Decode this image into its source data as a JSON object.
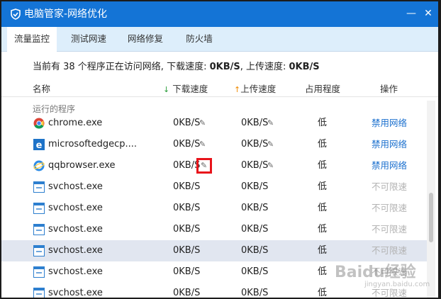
{
  "window": {
    "title": "电脑管家-网络优化",
    "minimize_glyph": "—",
    "close_glyph": "✕"
  },
  "tabs": [
    {
      "label": "流量监控",
      "active": true
    },
    {
      "label": "测试网速",
      "active": false
    },
    {
      "label": "网络修复",
      "active": false
    },
    {
      "label": "防火墙",
      "active": false
    }
  ],
  "summary": {
    "prefix": "当前有 38 个程序正在访问网络, 下载速度: ",
    "download": "0KB/S",
    "mid": ", 上传速度: ",
    "upload": "0KB/S"
  },
  "columns": {
    "name": "名称",
    "download": "下载速度",
    "upload": "上传速度",
    "usage": "占用程度",
    "action": "操作"
  },
  "group_label": "运行的程序",
  "rows": [
    {
      "name": "chrome.exe",
      "icon": "chrome-icon",
      "down": "0KB/S",
      "up": "0KB/S",
      "usage": "低",
      "action": "禁用网络"
    },
    {
      "name": "microsoftedgecp....",
      "icon": "edge-icon",
      "down": "0KB/S",
      "up": "0KB/S",
      "usage": "低",
      "action": "禁用网络"
    },
    {
      "name": "qqbrowser.exe",
      "icon": "qqbrowser-icon",
      "down": "0KB/S",
      "up": "0KB/S",
      "usage": "低",
      "action": "禁用网络"
    },
    {
      "name": "svchost.exe",
      "icon": "service-window-icon",
      "down": "0KB/S",
      "up": "0KB/S",
      "usage": "低",
      "action": "不可限速"
    },
    {
      "name": "svchost.exe",
      "icon": "service-window-icon",
      "down": "0KB/S",
      "up": "0KB/S",
      "usage": "低",
      "action": "不可限速"
    },
    {
      "name": "svchost.exe",
      "icon": "service-window-icon",
      "down": "0KB/S",
      "up": "0KB/S",
      "usage": "低",
      "action": "不可限速"
    },
    {
      "name": "svchost.exe",
      "icon": "service-window-icon",
      "down": "0KB/S",
      "up": "0KB/S",
      "usage": "低",
      "action": "不可限速"
    },
    {
      "name": "svchost.exe",
      "icon": "service-window-icon",
      "down": "0KB/S",
      "up": "0KB/S",
      "usage": "低",
      "action": "不可限速"
    },
    {
      "name": "svchost.exe",
      "icon": "service-window-icon",
      "down": "0KB/S",
      "up": "0KB/S",
      "usage": "低",
      "action": "不可限速"
    }
  ],
  "watermark": {
    "text": "Baidu经验",
    "sub": "jingyan.baidu.com"
  },
  "colors": {
    "titlebar": "#1474d6",
    "link": "#1a6fce",
    "highlight_box": "#e8141b"
  }
}
